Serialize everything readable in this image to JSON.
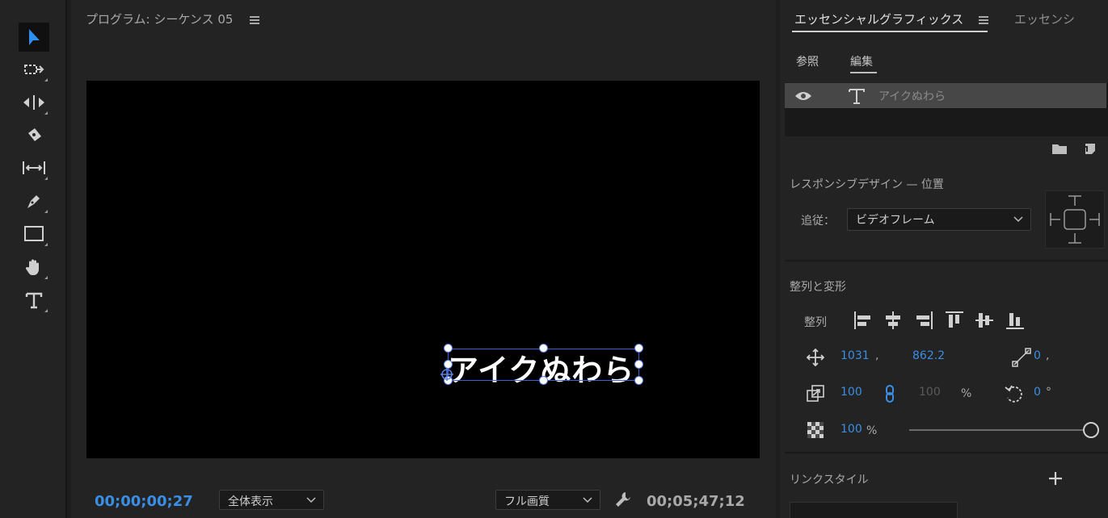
{
  "tools": [
    {
      "name": "selection-tool",
      "icon": "arrow-icon",
      "active": true
    },
    {
      "name": "track-select-tool",
      "icon": "track-select-icon"
    },
    {
      "name": "ripple-edit-tool",
      "icon": "ripple-edit-icon"
    },
    {
      "name": "razor-tool",
      "icon": "razor-icon"
    },
    {
      "name": "slip-tool",
      "icon": "slip-icon"
    },
    {
      "name": "pen-tool",
      "icon": "pen-icon"
    },
    {
      "name": "rectangle-tool",
      "icon": "rectangle-icon"
    },
    {
      "name": "hand-tool",
      "icon": "hand-icon"
    },
    {
      "name": "type-tool",
      "icon": "type-icon"
    }
  ],
  "monitor": {
    "title": "プログラム: シーケンス 05",
    "overlay_text": "アイクぬわら",
    "timecode_current": "00;00;00;27",
    "timecode_duration": "00;05;47;12",
    "zoom_select": "全体表示",
    "quality_select": "フル画質"
  },
  "essential_graphics": {
    "tab_active": "エッセンシャルグラフィックス",
    "tab_other": "エッセンシ",
    "subtab_browse": "参照",
    "subtab_edit": "編集",
    "layer_name": "アイクぬわら",
    "responsive_title": "レスポンシブデザイン — 位置",
    "follow_label": "追従：",
    "follow_value": "ビデオフレーム",
    "align_title": "整列と変形",
    "align_label": "整列",
    "position_x": "1031",
    "position_comma": ",",
    "position_y": "862.2",
    "anchor_x": "0",
    "anchor_comma": ",",
    "scale_w": "100",
    "scale_h": "100",
    "scale_unit": "%",
    "rotation": "0",
    "rotation_unit": "°",
    "opacity": "100",
    "opacity_unit": "%",
    "opacity_level": 1.0,
    "linked_styles_title": "リンクスタイル"
  }
}
